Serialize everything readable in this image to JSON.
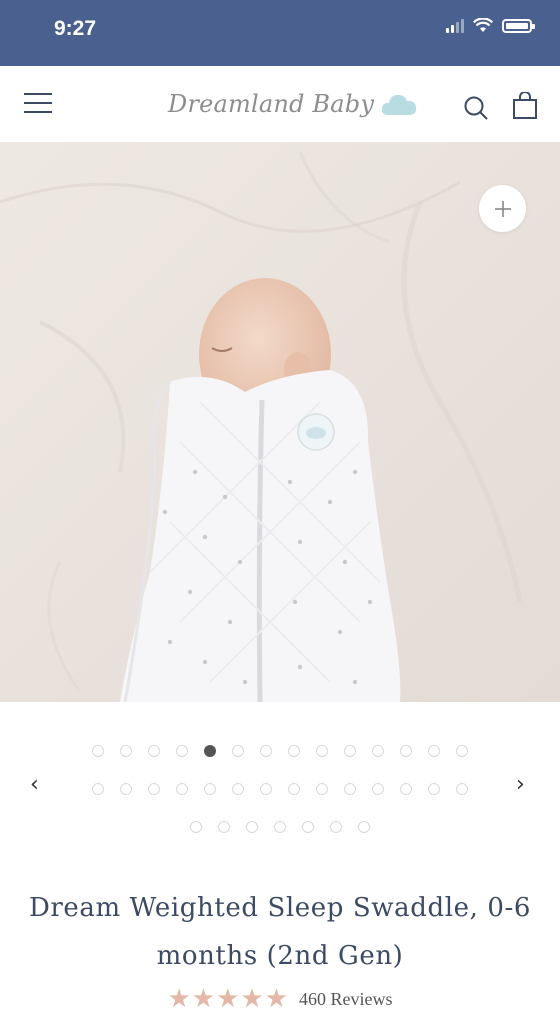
{
  "status_bar": {
    "time": "9:27",
    "icons": [
      "signal-icon",
      "wifi-icon",
      "battery-icon"
    ]
  },
  "header": {
    "brand": "Dreamland Baby",
    "icons": [
      "menu-icon",
      "cloud-logo-icon",
      "search-icon",
      "shopping-bag-icon"
    ]
  },
  "gallery": {
    "image_alt": "baby-in-swaddle",
    "zoom_icon": "plus-icon",
    "prev_icon": "chevron-left-icon",
    "next_icon": "chevron-right-icon",
    "dots_total": 35,
    "active_dot": 5,
    "prev_label": "‹",
    "next_label": "›"
  },
  "product": {
    "title": "Dream Weighted Sleep Swaddle, 0-6 months (2nd Gen)",
    "stars": "★★★★★",
    "rating_value": 5,
    "reviews": "460 Reviews"
  },
  "colors": {
    "status_bar": "#4a6190",
    "accent_text": "#3d4a63",
    "star": "#e4b8a6"
  }
}
